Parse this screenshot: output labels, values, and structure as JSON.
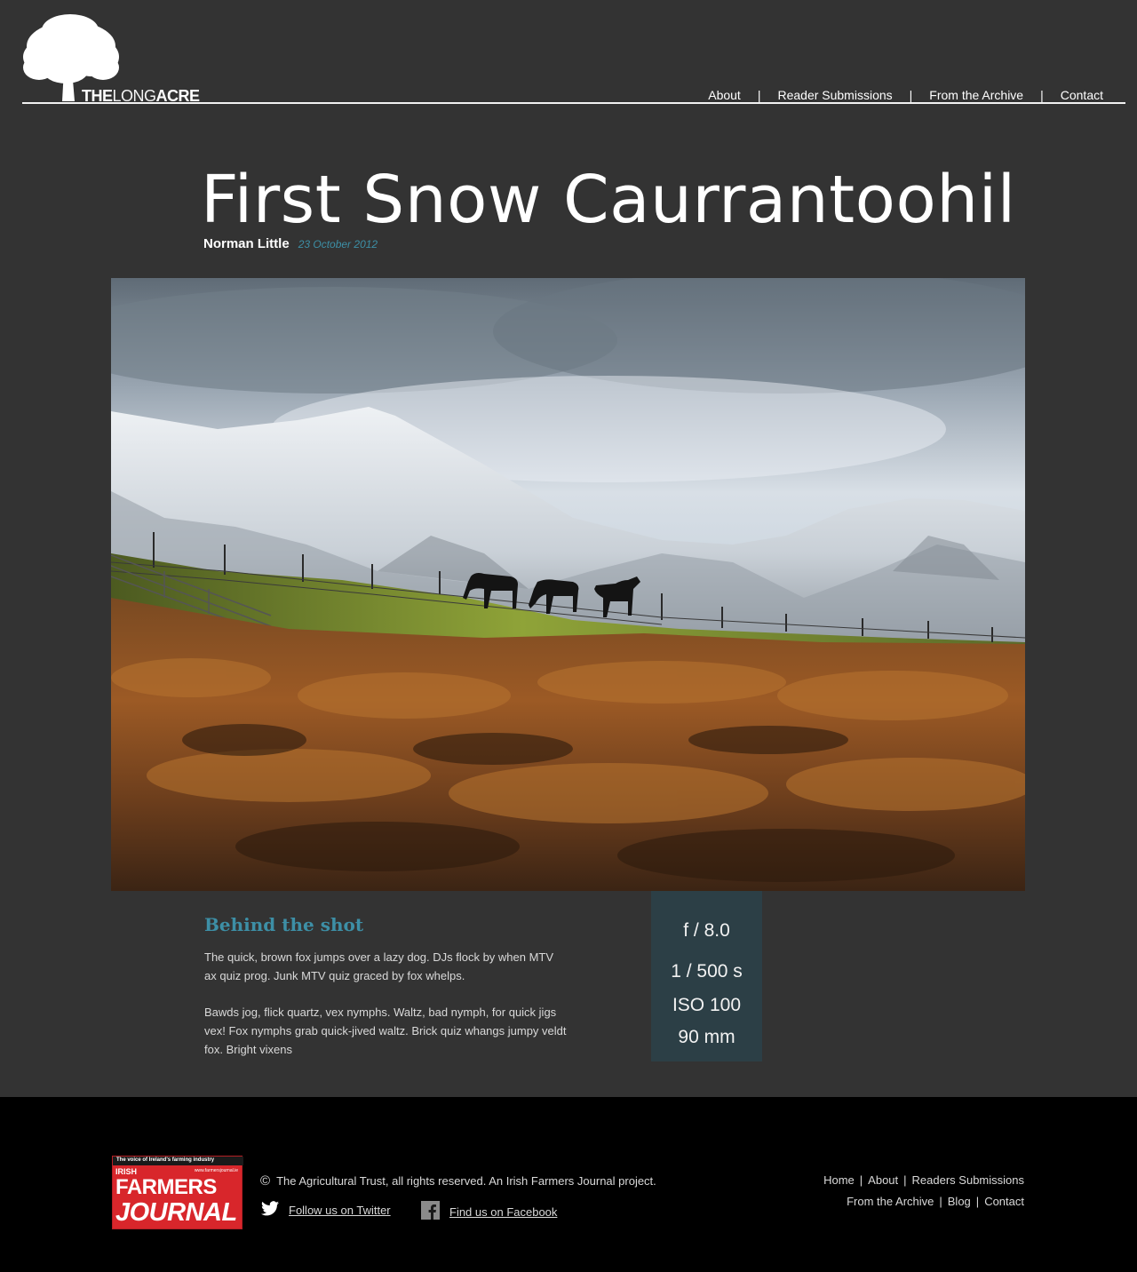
{
  "site": {
    "logo_bold": "THE",
    "logo_light": "LONG",
    "logo_bold2": "ACRE"
  },
  "nav": {
    "items": [
      "About",
      "Reader Submissions",
      "From the Archive",
      "Contact"
    ],
    "separator": "|"
  },
  "post": {
    "title": "First Snow Caurrantoohil",
    "author": "Norman Little",
    "date": "23 October 2012"
  },
  "behind": {
    "heading": "Behind the shot",
    "p1": "The quick, brown fox jumps over a lazy dog. DJs flock by when MTV ax quiz prog. Junk MTV quiz graced by fox whelps.",
    "p2": "Bawds jog, flick quartz, vex nymphs. Waltz, bad nymph, for quick jigs vex! Fox nymphs grab quick-jived waltz. Brick quiz whangs jumpy veldt fox. Bright vixens"
  },
  "exif": {
    "aperture_symbol": "f",
    "aperture": "/ 8.0",
    "shutter": "1 / 500",
    "shutter_unit": "s",
    "iso_label": "ISO",
    "iso": "100",
    "focal": "90",
    "focal_unit": "mm"
  },
  "footer": {
    "ifj_tag": "The voice of Ireland's farming industry",
    "ifj_irish": "IRISH",
    "ifj_url": "www.farmersjournal.ie",
    "ifj_farmers": "FARMERS",
    "ifj_journal": "JOURNAL",
    "copyright_symbol": "©",
    "copyright": "The Agricultural Trust, all rights reserved. An Irish Farmers Journal project.",
    "twitter": "Follow us on Twitter",
    "facebook": "Find us on Facebook",
    "links_row1": [
      "Home",
      "About",
      "Readers Submissions"
    ],
    "links_row2": [
      "From the Archive",
      "Blog",
      "Contact"
    ],
    "separator": "|"
  },
  "colors": {
    "background": "#333333",
    "accent": "#3d8fa6",
    "exif_bg": "#2c3f46",
    "footer_bg": "#000000",
    "ifj_red": "#d8262b"
  }
}
